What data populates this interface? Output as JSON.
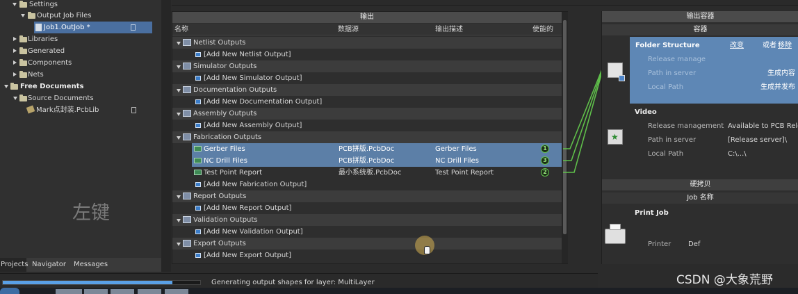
{
  "tree": {
    "settings": "Settings",
    "output_job_files": "Output Job Files",
    "job_file": "Job1.OutJob *",
    "libraries": "Libraries",
    "generated": "Generated",
    "components": "Components",
    "nets": "Nets",
    "free_documents": "Free Documents",
    "source_documents": "Source Documents",
    "pcblib": "Mark点封装.PcbLib"
  },
  "watermark_left": "左键",
  "bottom_tabs": [
    "Projects",
    "Navigator",
    "Messages"
  ],
  "status_text": "Generating output shapes for layer: MultiLayer",
  "progress": 0.86,
  "outputs": {
    "title": "输出",
    "columns": [
      "名称",
      "数据源",
      "输出描述",
      "使能的"
    ],
    "groups": [
      {
        "label": "Netlist Outputs",
        "add": "[Add New Netlist Output]"
      },
      {
        "label": "Simulator Outputs",
        "add": "[Add New Simulator Output]"
      },
      {
        "label": "Documentation Outputs",
        "add": "[Add New Documentation Output]"
      },
      {
        "label": "Assembly Outputs",
        "add": "[Add New Assembly Output]"
      },
      {
        "label": "Fabrication Outputs",
        "add": "[Add New Fabrication Output]"
      },
      {
        "label": "Report Outputs",
        "add": "[Add New Report Output]"
      },
      {
        "label": "Validation Outputs",
        "add": "[Add New Validation Output]"
      },
      {
        "label": "Export Outputs",
        "add": "[Add New Export Output]"
      }
    ],
    "fab_items": [
      {
        "name": "Gerber Files",
        "source": "PCB拼版.PcbDoc",
        "desc": "Gerber Files",
        "badge": "1"
      },
      {
        "name": "NC Drill Files",
        "source": "PCB拼版.PcbDoc",
        "desc": "NC Drill Files",
        "badge": "3"
      },
      {
        "name": "Test Point Report",
        "source": "最小系统板.PcbDoc",
        "desc": "Test Point Report",
        "badge": "2"
      }
    ]
  },
  "containers": {
    "title": "输出容器",
    "sub": "容器",
    "folder": {
      "title": "Folder Structure",
      "change": "改变",
      "or": "或者",
      "remove": "移除",
      "rows": [
        {
          "label": "Release manage",
          "value": ""
        },
        {
          "label": "Path in server",
          "value": "生成内容"
        },
        {
          "label": "Local Path",
          "value": "生成并发布"
        }
      ]
    },
    "video": {
      "title": "Video",
      "rows": [
        {
          "label": "Release management",
          "value": "Available to PCB Relea"
        },
        {
          "label": "Path in server",
          "value": "[Release server]\\"
        },
        {
          "label": "Local Path",
          "value": "C:\\...\\"
        }
      ]
    },
    "hardcopy": "硬拷贝",
    "job_name": "Job 名称",
    "print_job": "Print Job",
    "printer_label": "Printer",
    "printer_value": "Def"
  },
  "watermark": "CSDN @大象荒野"
}
